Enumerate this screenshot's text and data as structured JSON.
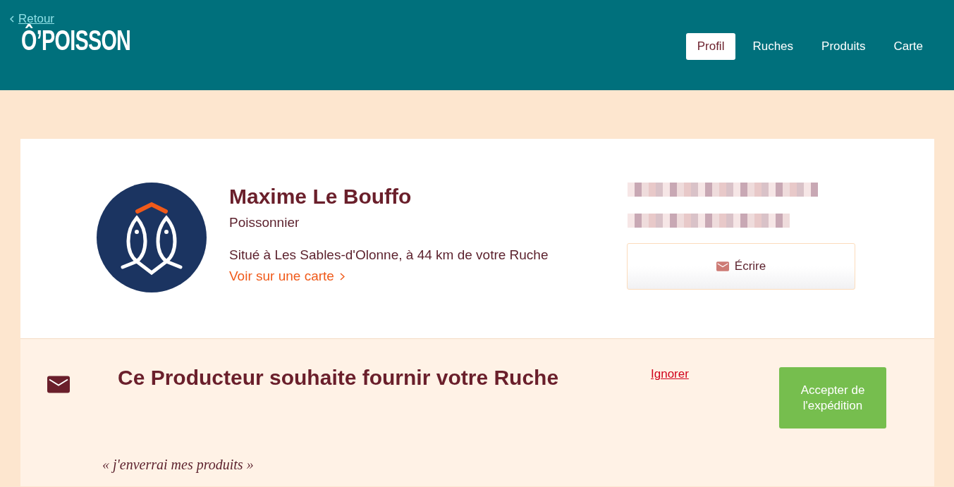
{
  "header": {
    "back_link": "Retour",
    "logo": "Ô’POISSON",
    "nav": [
      {
        "label": "Profil",
        "selected": true
      },
      {
        "label": "Ruches",
        "selected": false
      },
      {
        "label": "Produits",
        "selected": false
      },
      {
        "label": "Carte",
        "selected": false
      }
    ]
  },
  "profile": {
    "name": "Maxime Le Bouffo",
    "role": "Poissonnier",
    "location": "Situé à Les Sables-d'Olonne, à 44 km de votre Ruche",
    "map_link": "Voir sur une carte",
    "contact": [
      {
        "kind": "redacted"
      },
      {
        "kind": "redacted"
      }
    ],
    "write_button": "Écrire"
  },
  "invitation": {
    "title": "Ce Producteur souhaite fournir votre Ruche",
    "ignore": "Ignorer",
    "accept": "Accepter de l'expédition",
    "quote": "« j'enverrai mes produits »"
  }
}
